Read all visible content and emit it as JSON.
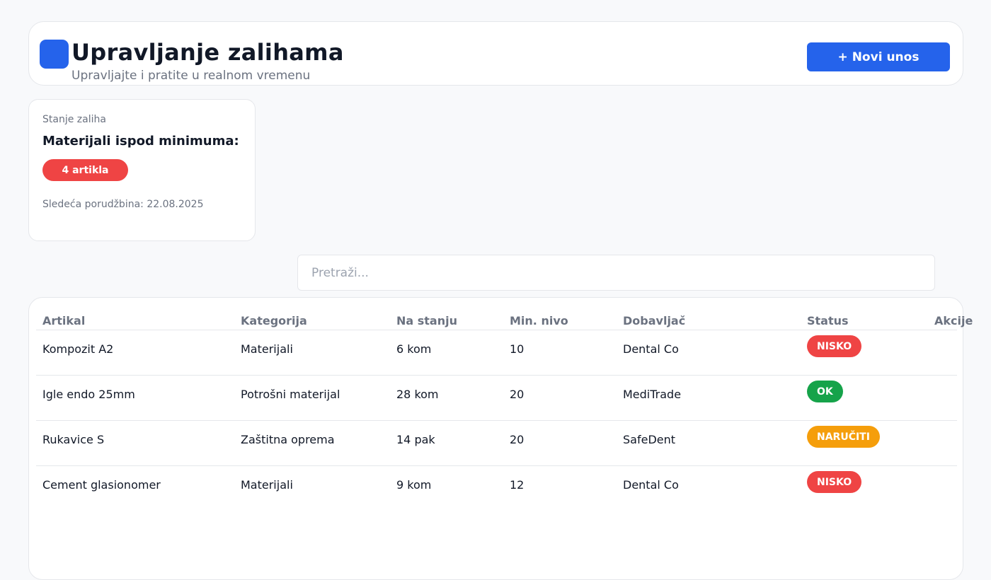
{
  "header": {
    "title": "Upravljanje zalihama",
    "subtitle": "Upravljajte i pratite u realnom vremenu",
    "new_button": "+ Novi unos"
  },
  "stock_card": {
    "label": "Stanje zaliha",
    "heading": "Materijali ispod minimuma:",
    "badge": "4 artikla",
    "next_order": "Sledeća porudžbina: 22.08.2025"
  },
  "search": {
    "placeholder": "Pretraži..."
  },
  "table": {
    "columns": [
      "Artikal",
      "Kategorija",
      "Na stanju",
      "Min. nivo",
      "Dobavljač",
      "Status",
      "Akcije"
    ],
    "rows": [
      {
        "item": "Kompozit A2",
        "category": "Materijali",
        "stock": "6 kom",
        "min": "10",
        "supplier": "Dental Co",
        "status": "NISKO"
      },
      {
        "item": "Igle endo 25mm",
        "category": "Potrošni materijal",
        "stock": "28 kom",
        "min": "20",
        "supplier": "MediTrade",
        "status": "OK"
      },
      {
        "item": "Rukavice S",
        "category": "Zaštitna oprema",
        "stock": "14 pak",
        "min": "20",
        "supplier": "SafeDent",
        "status": "NARUČITI"
      },
      {
        "item": "Cement glasionomer",
        "category": "Materijali",
        "stock": "9 kom",
        "min": "12",
        "supplier": "Dental Co",
        "status": "NISKO"
      }
    ]
  },
  "colors": {
    "accent": "#2563eb",
    "status_low": "#ef4444",
    "status_ok": "#16a34a",
    "status_order": "#f59e0b"
  }
}
